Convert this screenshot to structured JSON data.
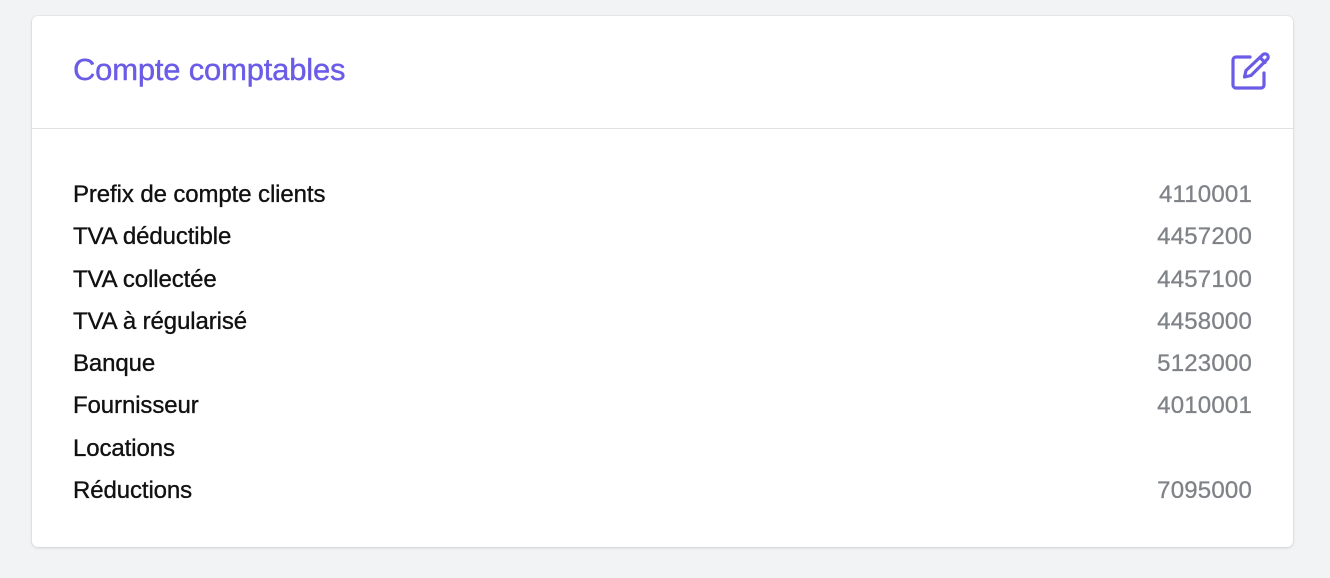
{
  "card": {
    "title": "Compte comptables",
    "edit_icon": "edit-icon",
    "accent_color": "#6b5ce7"
  },
  "accounts": [
    {
      "label": "Prefix de compte clients",
      "value": "4110001"
    },
    {
      "label": "TVA déductible",
      "value": "4457200"
    },
    {
      "label": "TVA collectée",
      "value": "4457100"
    },
    {
      "label": "TVA à régularisé",
      "value": "4458000"
    },
    {
      "label": "Banque",
      "value": "5123000"
    },
    {
      "label": "Fournisseur",
      "value": "4010001"
    },
    {
      "label": "Locations",
      "value": ""
    },
    {
      "label": "Réductions",
      "value": "7095000"
    }
  ]
}
